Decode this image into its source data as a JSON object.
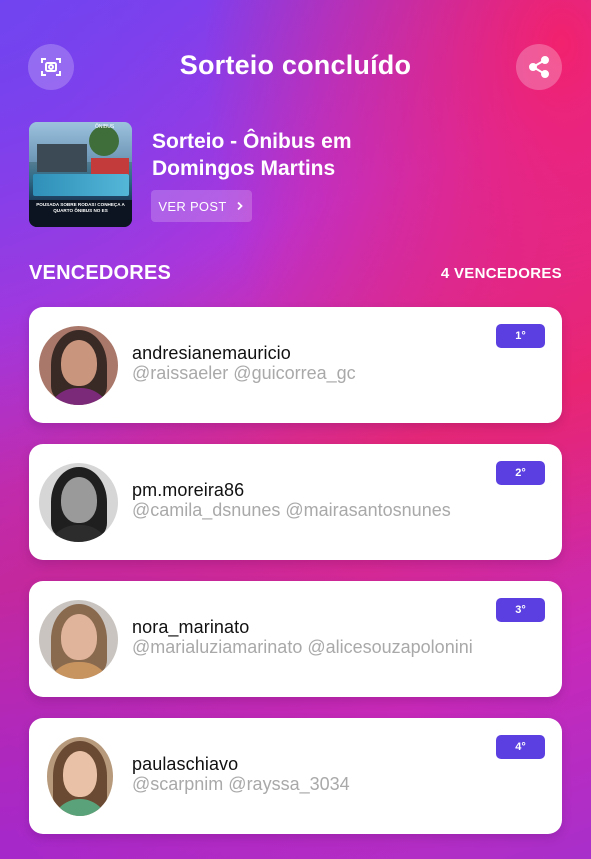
{
  "header": {
    "title": "Sorteio concluído",
    "left_icon": "camera-scan-icon",
    "right_icon": "share-icon"
  },
  "post": {
    "title": "Sorteio - Ônibus em Domingos Martins",
    "button_label": "VER POST",
    "thumbnail_text": "POUSADA SOBRE RODAS! CONHEÇA A QUARTO ÔNIBUS NO ES",
    "thumbnail_logo": "ÔNIBUS"
  },
  "winners_section": {
    "title": "VENCEDORES",
    "count_label": "4 VENCEDORES"
  },
  "winners": [
    {
      "rank": "1°",
      "username": "andresianemauricio",
      "mentions": "@raissaeler @guicorrea_gc"
    },
    {
      "rank": "2°",
      "username": "pm.moreira86",
      "mentions": "@camila_dsnunes @mairasantosnunes"
    },
    {
      "rank": "3°",
      "username": "nora_marinato",
      "mentions": "@marialuziamarinato @alicesouzapolonini"
    },
    {
      "rank": "4°",
      "username": "paulaschiavo",
      "mentions": "@scarpnim @rayssa_3034"
    }
  ],
  "colors": {
    "badge": "#5b3fe0",
    "gradient_start": "#7a3ef0",
    "gradient_mid": "#e0287c",
    "gradient_end": "#a82fcb"
  }
}
